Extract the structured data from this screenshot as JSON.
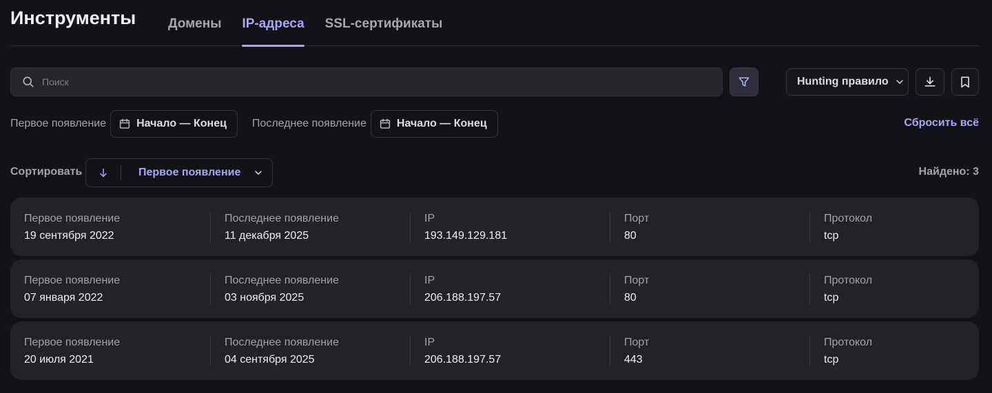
{
  "header": {
    "title": "Инструменты",
    "tabs": [
      {
        "label": "Домены",
        "active": false
      },
      {
        "label": "IP-адреса",
        "active": true
      },
      {
        "label": "SSL-сертификаты",
        "active": false
      }
    ]
  },
  "toolbar": {
    "search_placeholder": "Поиск",
    "hunting_label": "Hunting правило"
  },
  "dates": {
    "first_label": "Первое появление",
    "first_range": "Начало — Конец",
    "last_label": "Последнее появление",
    "last_range": "Начало — Конец",
    "reset_label": "Сбросить всё"
  },
  "sort": {
    "label": "Сортировать",
    "field": "Первое появление",
    "found": "Найдено: 3"
  },
  "columns": [
    "Первое появление",
    "Последнее появление",
    "IP",
    "Порт",
    "Протокол"
  ],
  "rows": [
    {
      "first": "19 сентября 2022",
      "last": "11 декабря 2025",
      "ip": "193.149.129.181",
      "port": "80",
      "protocol": "tcp"
    },
    {
      "first": "07 января 2022",
      "last": "03 ноября 2025",
      "ip": "206.188.197.57",
      "port": "80",
      "protocol": "tcp"
    },
    {
      "first": "20 июля 2021",
      "last": "04 сентября 2025",
      "ip": "206.188.197.57",
      "port": "443",
      "protocol": "tcp"
    }
  ],
  "colors": {
    "accent": "#a9a6f6",
    "background": "#131317",
    "card": "#222227"
  }
}
